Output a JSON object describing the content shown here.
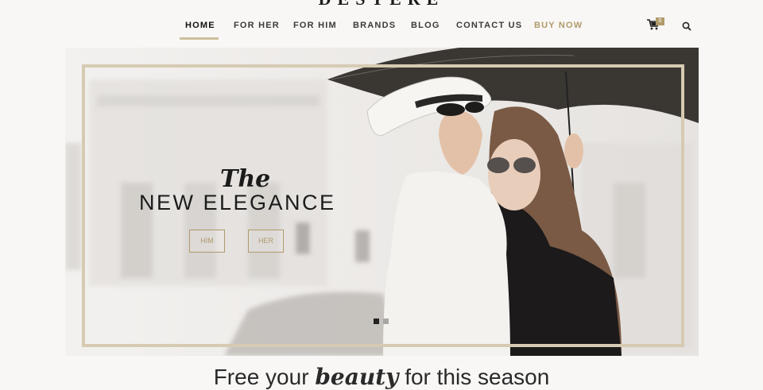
{
  "site": {
    "logo": "DESTERE"
  },
  "nav": {
    "items": [
      {
        "label": "HOME"
      },
      {
        "label": "FOR HER"
      },
      {
        "label": "FOR HIM"
      },
      {
        "label": "BRANDS"
      },
      {
        "label": "BLOG"
      },
      {
        "label": "CONTACT US"
      },
      {
        "label": "BUY NOW"
      }
    ],
    "active_item": "HOME",
    "cart_count": "0",
    "icons": [
      "cart-icon",
      "search-icon"
    ]
  },
  "hero": {
    "the_text": "The",
    "title": "NEW ELEGANCE",
    "buttons": [
      {
        "label": "HIM"
      },
      {
        "label": "HER"
      }
    ],
    "slides_total": 2,
    "slide_active": 1
  },
  "tagline": {
    "before": "Free your ",
    "emphasis": "beauty",
    "after": " for this season"
  },
  "colors": {
    "accent": "#b09a6a",
    "frame": "#d6cbb2",
    "background": "#f8f7f5",
    "text": "#1b1b1b"
  }
}
